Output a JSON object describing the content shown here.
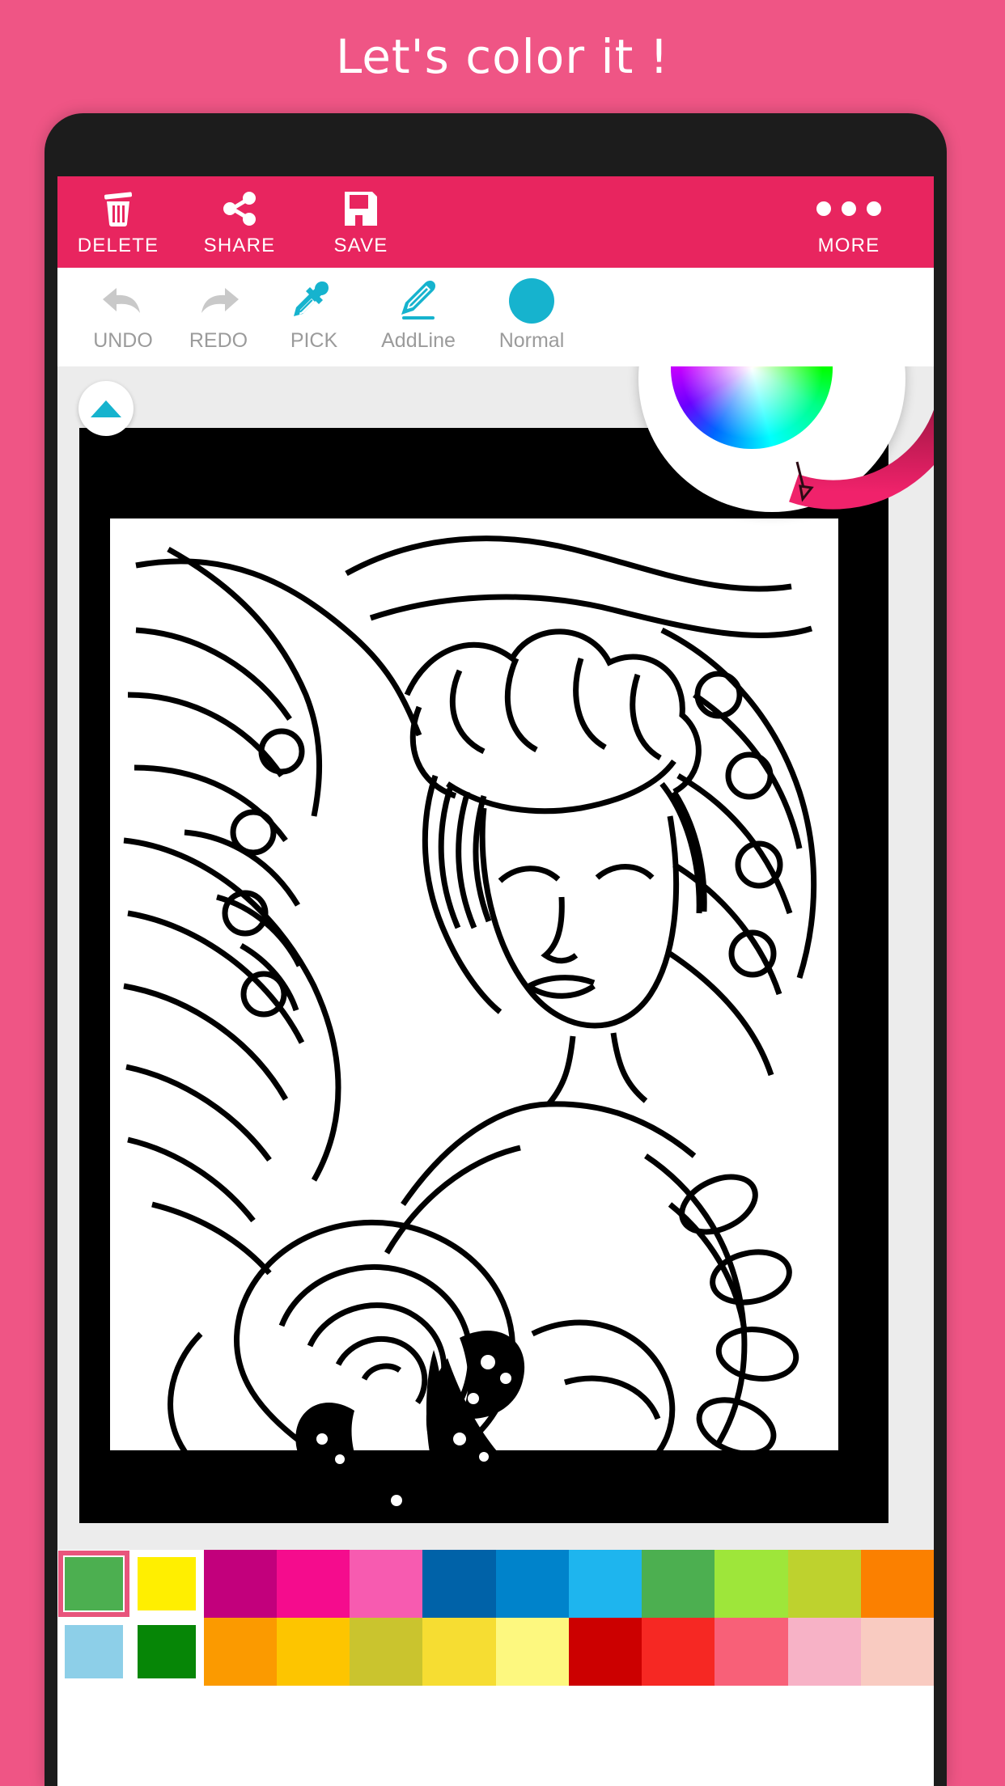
{
  "promo": {
    "title": "Let's color it !"
  },
  "appbar": {
    "background": "#e8255f",
    "items": [
      {
        "label": "DELETE",
        "icon": "trash-icon"
      },
      {
        "label": "SHARE",
        "icon": "share-icon"
      },
      {
        "label": "SAVE",
        "icon": "save-icon"
      },
      {
        "label": "MORE",
        "icon": "more-dots-icon"
      }
    ]
  },
  "toolbar": {
    "items": [
      {
        "label": "UNDO",
        "icon": "undo-arrow-icon",
        "state": "disabled",
        "color": "#c9c9c9"
      },
      {
        "label": "REDO",
        "icon": "redo-arrow-icon",
        "state": "disabled",
        "color": "#c9c9c9"
      },
      {
        "label": "PICK",
        "icon": "eyedropper-icon",
        "state": "enabled",
        "color": "#16b3ce"
      },
      {
        "label": "AddLine",
        "icon": "pencil-icon",
        "state": "enabled",
        "color": "#16b3ce"
      },
      {
        "label": "Normal",
        "icon": "brush-mode-circle",
        "state": "enabled",
        "color": "#16b3ce"
      }
    ]
  },
  "canvas": {
    "collapse_icon": "chevron-up-icon",
    "accent": "#16b3ce",
    "artwork_alt": "fairy-with-flowers-coloring-page"
  },
  "color_wheel": {
    "visible": true,
    "cursor_color": "#ff1a6a",
    "arc_from": "#2d0a16",
    "arc_to": "#f0226b"
  },
  "palette": {
    "selection_border": "#e8557c",
    "row1": [
      {
        "color": "#4caf50",
        "selected": true,
        "framed": true
      },
      {
        "color": "#ffef00",
        "selected": false,
        "framed": true
      },
      {
        "color": "#c2007c",
        "selected": false,
        "framed": false
      },
      {
        "color": "#f50c8d",
        "selected": false,
        "framed": false
      },
      {
        "color": "#f75bb0",
        "selected": false,
        "framed": false
      },
      {
        "color": "#0062a8",
        "selected": false,
        "framed": false
      },
      {
        "color": "#0083cb",
        "selected": false,
        "framed": false
      },
      {
        "color": "#1eb5ee",
        "selected": false,
        "framed": false
      },
      {
        "color": "#4caf50",
        "selected": false,
        "framed": false
      },
      {
        "color": "#9ee63a",
        "selected": false,
        "framed": false
      },
      {
        "color": "#bed22e",
        "selected": false,
        "framed": false
      },
      {
        "color": "#fb8000",
        "selected": false,
        "framed": false
      }
    ],
    "row2": [
      {
        "color": "#8dcfe8",
        "selected": false,
        "framed": true
      },
      {
        "color": "#068606",
        "selected": false,
        "framed": true
      },
      {
        "color": "#fb9a00",
        "selected": false,
        "framed": false
      },
      {
        "color": "#fdc500",
        "selected": false,
        "framed": false
      },
      {
        "color": "#cac42e",
        "selected": false,
        "framed": false
      },
      {
        "color": "#f6dd32",
        "selected": false,
        "framed": false
      },
      {
        "color": "#fdf87f",
        "selected": false,
        "framed": false
      },
      {
        "color": "#cc0000",
        "selected": false,
        "framed": false
      },
      {
        "color": "#f62823",
        "selected": false,
        "framed": false
      },
      {
        "color": "#f86078",
        "selected": false,
        "framed": false
      },
      {
        "color": "#f7b2c6",
        "selected": false,
        "framed": false
      },
      {
        "color": "#f9cbc1",
        "selected": false,
        "framed": false
      }
    ]
  }
}
